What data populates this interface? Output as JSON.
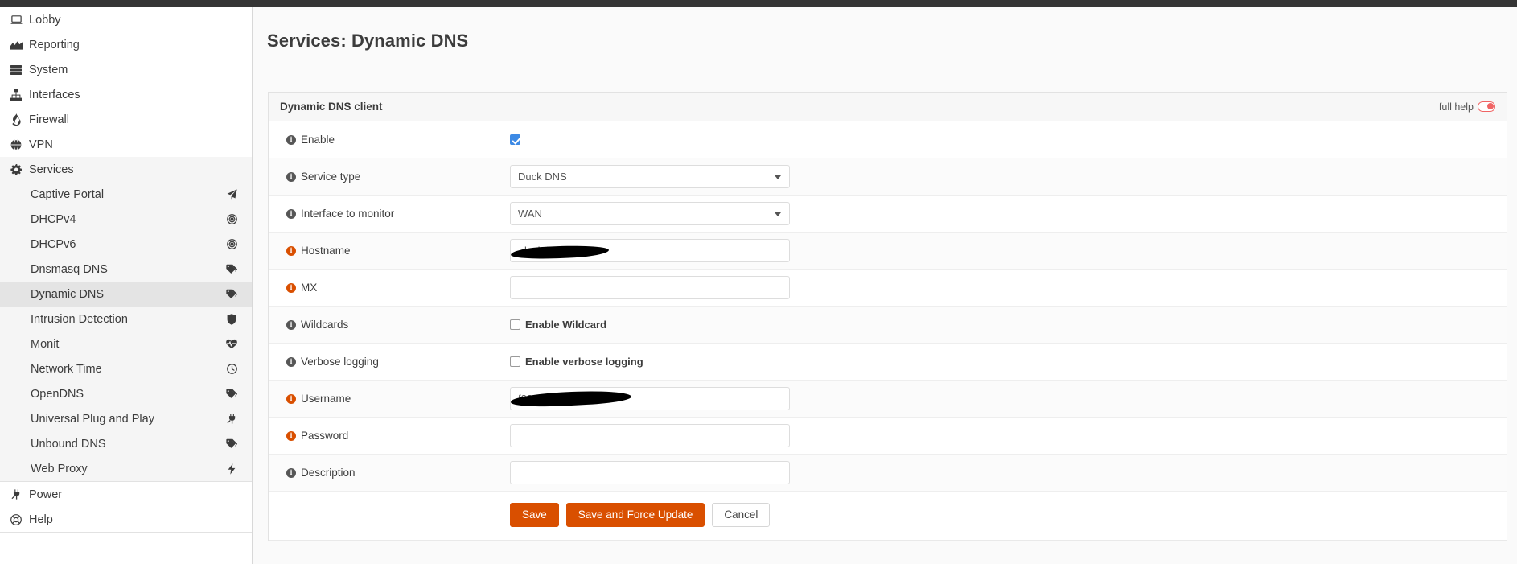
{
  "app": {
    "accent_orange": "#d94f00",
    "checkbox_blue": "#3d8ae5",
    "toggle_red": "#f06464",
    "topbar_color": "#353535"
  },
  "sidebar": {
    "top_items": [
      {
        "label": "Lobby",
        "icon": "laptop-icon"
      },
      {
        "label": "Reporting",
        "icon": "chart-area-icon"
      },
      {
        "label": "System",
        "icon": "server-icon"
      },
      {
        "label": "Interfaces",
        "icon": "sitemap-icon"
      },
      {
        "label": "Firewall",
        "icon": "fire-icon"
      },
      {
        "label": "VPN",
        "icon": "globe-icon"
      },
      {
        "label": "Services",
        "icon": "gear-icon"
      }
    ],
    "services_children": [
      {
        "label": "Captive Portal",
        "icon": "paper-plane-icon",
        "selected": false
      },
      {
        "label": "DHCPv4",
        "icon": "bullseye-icon",
        "selected": false
      },
      {
        "label": "DHCPv6",
        "icon": "bullseye-icon",
        "selected": false
      },
      {
        "label": "Dnsmasq DNS",
        "icon": "tags-icon",
        "selected": false
      },
      {
        "label": "Dynamic DNS",
        "icon": "tags-icon",
        "selected": true
      },
      {
        "label": "Intrusion Detection",
        "icon": "shield-icon",
        "selected": false
      },
      {
        "label": "Monit",
        "icon": "heartbeat-icon",
        "selected": false
      },
      {
        "label": "Network Time",
        "icon": "clock-icon",
        "selected": false
      },
      {
        "label": "OpenDNS",
        "icon": "tags-icon",
        "selected": false
      },
      {
        "label": "Universal Plug and Play",
        "icon": "plug-icon",
        "selected": false
      },
      {
        "label": "Unbound DNS",
        "icon": "tags-icon",
        "selected": false
      },
      {
        "label": "Web Proxy",
        "icon": "bolt-icon",
        "selected": false
      }
    ],
    "bottom_items": [
      {
        "label": "Power",
        "icon": "plug-icon"
      },
      {
        "label": "Help",
        "icon": "lifering-icon"
      }
    ]
  },
  "page": {
    "title": "Services: Dynamic DNS"
  },
  "panel": {
    "heading": "Dynamic DNS client",
    "full_help_label": "full help",
    "rows": {
      "enable": {
        "label": "Enable",
        "required": false,
        "checked": true
      },
      "service_type": {
        "label": "Service type",
        "required": false,
        "value": "Duck DNS",
        "options": [
          "Duck DNS"
        ]
      },
      "interface": {
        "label": "Interface to monitor",
        "required": false,
        "value": "WAN",
        "options": [
          "WAN"
        ]
      },
      "hostname": {
        "label": "Hostname",
        "required": true,
        "value": ".duckdns.org",
        "redacted": true,
        "placeholder": ""
      },
      "mx": {
        "label": "MX",
        "required": true,
        "value": "",
        "placeholder": ""
      },
      "wildcards": {
        "label": "Wildcards",
        "required": false,
        "checkbox_label": "Enable Wildcard",
        "checked": false
      },
      "verbose": {
        "label": "Verbose logging",
        "required": false,
        "checkbox_label": "Enable verbose logging",
        "checked": false
      },
      "username": {
        "label": "Username",
        "required": true,
        "value": "f2318287bd0",
        "redacted": true,
        "placeholder": ""
      },
      "password": {
        "label": "Password",
        "required": true,
        "value": "",
        "placeholder": ""
      },
      "description": {
        "label": "Description",
        "required": false,
        "value": "",
        "placeholder": ""
      }
    },
    "buttons": {
      "save": "Save",
      "save_force": "Save and Force Update",
      "cancel": "Cancel"
    }
  }
}
